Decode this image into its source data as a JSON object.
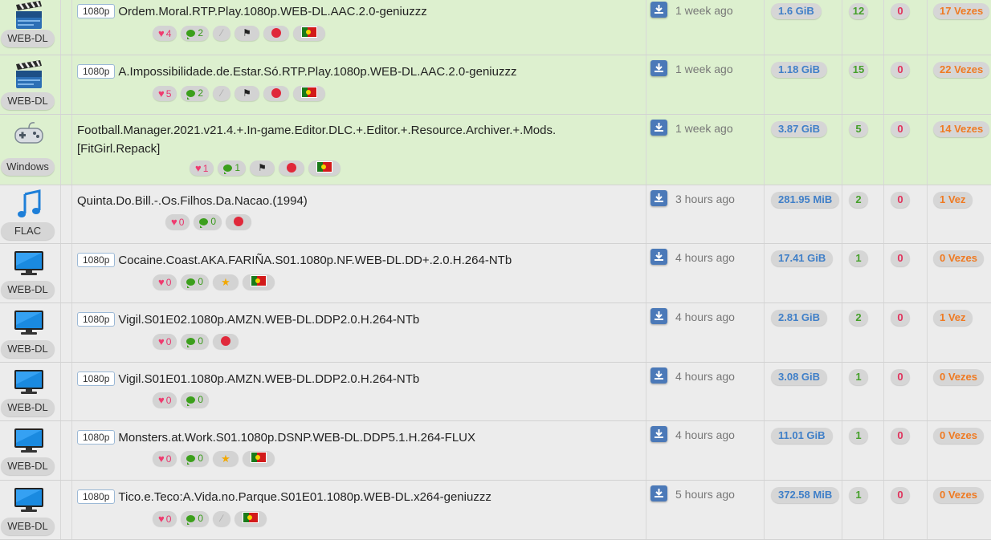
{
  "icons": {
    "download": "download-icon",
    "like": "heart-icon",
    "comment": "comment-icon",
    "gauge": "speedometer-icon",
    "pin": "pin-icon",
    "wand": "magic-wand-icon",
    "star": "star-icon",
    "flag": "portugal-flag-icon"
  },
  "colors": {
    "row_green": "#ddf0cf",
    "row_gray": "#ececec",
    "size": "#3f7fc8",
    "seeders": "#45a02a",
    "leechers": "#e0305a",
    "completed": "#ef7a22",
    "download_button": "#4b79b8"
  },
  "torrents": [
    {
      "category": "WEB-DL",
      "category_icon": "clapperboard-icon",
      "resolution": "1080p",
      "name": "Ordem.Moral.RTP.Play.1080p.WEB-DL.AAC.2.0-geniuzzz",
      "likes": "4",
      "comments": "2",
      "time": "1 week ago",
      "size": "1.6 GiB",
      "seeders": "12",
      "leechers": "0",
      "completed": "17 Vezes"
    },
    {
      "category": "WEB-DL",
      "category_icon": "clapperboard-icon",
      "resolution": "1080p",
      "name": "A.Impossibilidade.de.Estar.Só.RTP.Play.1080p.WEB-DL.AAC.2.0-geniuzzz",
      "likes": "5",
      "comments": "2",
      "time": "1 week ago",
      "size": "1.18 GiB",
      "seeders": "15",
      "leechers": "0",
      "completed": "22 Vezes"
    },
    {
      "category": "Windows",
      "category_icon": "gamepad-icon",
      "name_line1": "Football.Manager.2021.v21.4.+.In-game.Editor.DLC.+.Editor.+.Resource.Archiver.+.Mods.",
      "name_line2": "[FitGirl.Repack]",
      "likes": "1",
      "comments": "1",
      "time": "1 week ago",
      "size": "3.87 GiB",
      "seeders": "5",
      "leechers": "0",
      "completed": "14 Vezes"
    },
    {
      "category": "FLAC",
      "category_icon": "music-note-icon",
      "name": "Quinta.Do.Bill.-.Os.Filhos.Da.Nacao.(1994)",
      "likes": "0",
      "comments": "0",
      "time": "3 hours ago",
      "size": "281.95 MiB",
      "seeders": "2",
      "leechers": "0",
      "completed": "1 Vez"
    },
    {
      "category": "WEB-DL",
      "category_icon": "tv-icon",
      "resolution": "1080p",
      "name": "Cocaine.Coast.AKA.FARIÑA.S01.1080p.NF.WEB-DL.DD+.2.0.H.264-NTb",
      "likes": "0",
      "comments": "0",
      "time": "4 hours ago",
      "size": "17.41 GiB",
      "seeders": "1",
      "leechers": "0",
      "completed": "0 Vezes"
    },
    {
      "category": "WEB-DL",
      "category_icon": "tv-icon",
      "resolution": "1080p",
      "name": "Vigil.S01E02.1080p.AMZN.WEB-DL.DDP2.0.H.264-NTb",
      "likes": "0",
      "comments": "0",
      "time": "4 hours ago",
      "size": "2.81 GiB",
      "seeders": "2",
      "leechers": "0",
      "completed": "1 Vez"
    },
    {
      "category": "WEB-DL",
      "category_icon": "tv-icon",
      "resolution": "1080p",
      "name": "Vigil.S01E01.1080p.AMZN.WEB-DL.DDP2.0.H.264-NTb",
      "likes": "0",
      "comments": "0",
      "time": "4 hours ago",
      "size": "3.08 GiB",
      "seeders": "1",
      "leechers": "0",
      "completed": "0 Vezes"
    },
    {
      "category": "WEB-DL",
      "category_icon": "tv-icon",
      "resolution": "1080p",
      "name": "Monsters.at.Work.S01.1080p.DSNP.WEB-DL.DDP5.1.H.264-FLUX",
      "likes": "0",
      "comments": "0",
      "time": "4 hours ago",
      "size": "11.01 GiB",
      "seeders": "1",
      "leechers": "0",
      "completed": "0 Vezes"
    },
    {
      "category": "WEB-DL",
      "category_icon": "tv-icon",
      "resolution": "1080p",
      "name": "Tico.e.Teco:A.Vida.no.Parque.S01E01.1080p.WEB-DL.x264-geniuzzz",
      "likes": "0",
      "comments": "0",
      "time": "5 hours ago",
      "size": "372.58 MiB",
      "seeders": "1",
      "leechers": "0",
      "completed": "0 Vezes"
    }
  ]
}
